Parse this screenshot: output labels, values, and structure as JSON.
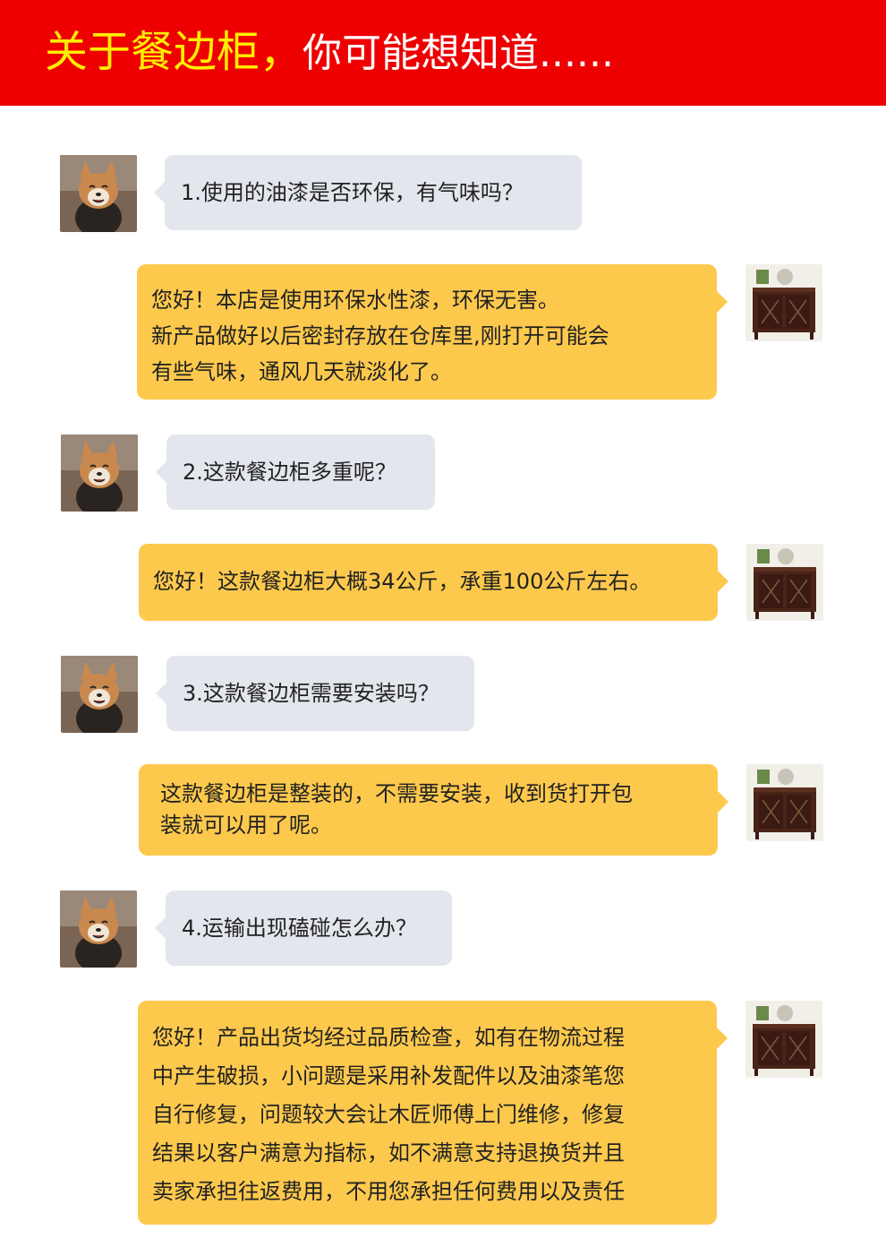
{
  "header": {
    "title_highlight": "关于餐边柜，",
    "title_rest": "你可能想知道......"
  },
  "faq": [
    {
      "question": "1.使用的油漆是否环保，有气味吗？",
      "answer_lines": [
        "您好！本店是使用环保水性漆，环保无害。",
        "新产品做好以后密封存放在仓库里,刚打开可能会",
        "有些气味，通风几天就淡化了。"
      ]
    },
    {
      "question": "2.这款餐边柜多重呢？",
      "answer_lines": [
        "您好！这款餐边柜大概34公斤，承重100公斤左右。"
      ]
    },
    {
      "question": "3.这款餐边柜需要安装吗？",
      "answer_lines": [
        "这款餐边柜是整装的，不需要安装，收到货打开包",
        "装就可以用了呢。"
      ]
    },
    {
      "question": "4.运输出现磕碰怎么办？",
      "answer_lines": [
        "您好！产品出货均经过品质检查，如有在物流过程",
        "中产生破损，小问题是采用补发配件以及油漆笔您",
        "自行修复，问题较大会让木匠师傅上门维修，修复",
        "结果以客户满意为指标，如不满意支持退换货并且",
        "卖家承担往返费用，不用您承担任何费用以及责任"
      ]
    }
  ],
  "colors": {
    "banner": "#ee0000",
    "highlight": "#ffee00",
    "question_bg": "#e4e6ee",
    "answer_bg": "#fdc94d"
  },
  "icons": {
    "customer_avatar": "shiba-dog-avatar",
    "shop_avatar": "sideboard-cabinet-avatar"
  }
}
